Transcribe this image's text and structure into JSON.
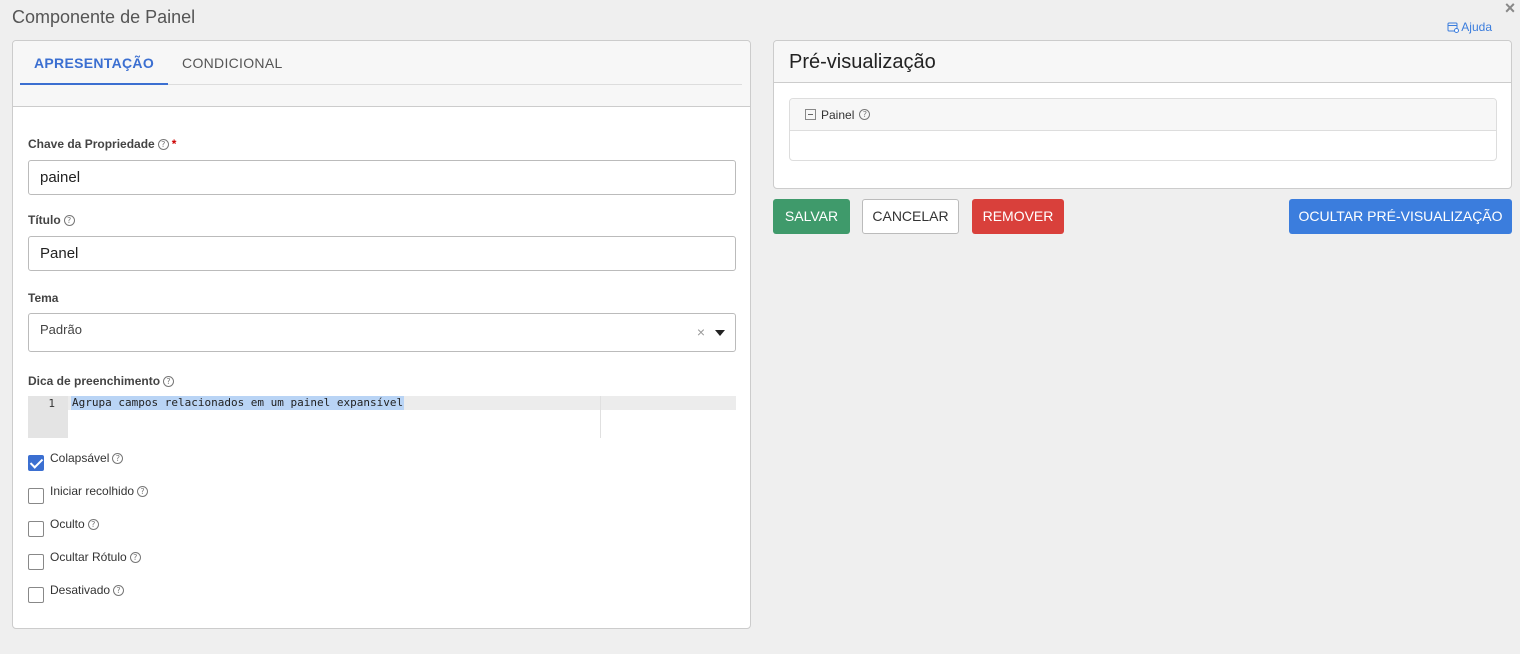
{
  "modal": {
    "title": "Componente de Painel",
    "close": "×",
    "help_label": "Ajuda"
  },
  "tabs": [
    {
      "label": "APRESENTAÇÃO",
      "active": true
    },
    {
      "label": "CONDICIONAL",
      "active": false
    }
  ],
  "form": {
    "key": {
      "label": "Chave da Propriedade",
      "required_mark": "*",
      "value": "painel"
    },
    "title": {
      "label": "Título",
      "value": "Panel"
    },
    "theme": {
      "label": "Tema",
      "value": "Padrão",
      "clear": "×"
    },
    "tooltip": {
      "label": "Dica de preenchimento",
      "line_number": "1",
      "text": "Agrupa campos relacionados em um painel expansível"
    },
    "checkboxes": [
      {
        "label": "Colapsável",
        "checked": true
      },
      {
        "label": "Iniciar recolhido",
        "checked": false
      },
      {
        "label": "Oculto",
        "checked": false
      },
      {
        "label": "Ocultar Rótulo",
        "checked": false
      },
      {
        "label": "Desativado",
        "checked": false
      }
    ]
  },
  "preview": {
    "title": "Pré-visualização",
    "panel_label": "Painel"
  },
  "actions": {
    "save": "SALVAR",
    "cancel": "CANCELAR",
    "remove": "REMOVER",
    "hide_preview": "OCULTAR PRÉ-VISUALIZAÇÃO"
  },
  "colors": {
    "accent": "#3b6fd1",
    "save": "#3f9a6b",
    "remove": "#d9403b",
    "hide_preview": "#3b7ddd"
  },
  "icons": {
    "help": "help-icon",
    "question": "question-circle-icon",
    "close": "close-icon",
    "collapse": "collapse-icon",
    "dropdown": "chevron-down-icon"
  }
}
